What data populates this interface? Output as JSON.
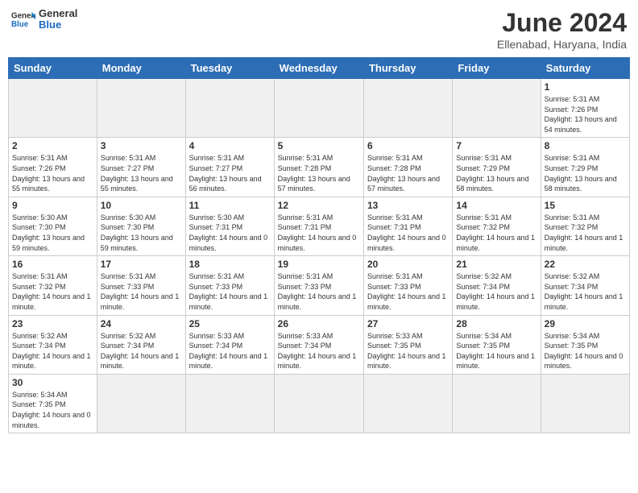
{
  "header": {
    "title": "June 2024",
    "location": "Ellenabad, Haryana, India",
    "logo_general": "General",
    "logo_blue": "Blue"
  },
  "days_of_week": [
    "Sunday",
    "Monday",
    "Tuesday",
    "Wednesday",
    "Thursday",
    "Friday",
    "Saturday"
  ],
  "weeks": [
    {
      "cells": [
        {
          "day": "",
          "empty": true
        },
        {
          "day": "",
          "empty": true
        },
        {
          "day": "",
          "empty": true
        },
        {
          "day": "",
          "empty": true
        },
        {
          "day": "",
          "empty": true
        },
        {
          "day": "",
          "empty": true
        },
        {
          "day": "1",
          "sunrise": "5:31 AM",
          "sunset": "7:26 PM",
          "daylight": "13 hours and 54 minutes."
        }
      ]
    },
    {
      "cells": [
        {
          "day": "2",
          "sunrise": "5:31 AM",
          "sunset": "7:26 PM",
          "daylight": "13 hours and 55 minutes."
        },
        {
          "day": "3",
          "sunrise": "5:31 AM",
          "sunset": "7:27 PM",
          "daylight": "13 hours and 55 minutes."
        },
        {
          "day": "4",
          "sunrise": "5:31 AM",
          "sunset": "7:27 PM",
          "daylight": "13 hours and 56 minutes."
        },
        {
          "day": "5",
          "sunrise": "5:31 AM",
          "sunset": "7:28 PM",
          "daylight": "13 hours and 57 minutes."
        },
        {
          "day": "6",
          "sunrise": "5:31 AM",
          "sunset": "7:28 PM",
          "daylight": "13 hours and 57 minutes."
        },
        {
          "day": "7",
          "sunrise": "5:31 AM",
          "sunset": "7:29 PM",
          "daylight": "13 hours and 58 minutes."
        },
        {
          "day": "8",
          "sunrise": "5:31 AM",
          "sunset": "7:29 PM",
          "daylight": "13 hours and 58 minutes."
        }
      ]
    },
    {
      "cells": [
        {
          "day": "9",
          "sunrise": "5:30 AM",
          "sunset": "7:30 PM",
          "daylight": "13 hours and 59 minutes."
        },
        {
          "day": "10",
          "sunrise": "5:30 AM",
          "sunset": "7:30 PM",
          "daylight": "13 hours and 59 minutes."
        },
        {
          "day": "11",
          "sunrise": "5:30 AM",
          "sunset": "7:31 PM",
          "daylight": "14 hours and 0 minutes."
        },
        {
          "day": "12",
          "sunrise": "5:31 AM",
          "sunset": "7:31 PM",
          "daylight": "14 hours and 0 minutes."
        },
        {
          "day": "13",
          "sunrise": "5:31 AM",
          "sunset": "7:31 PM",
          "daylight": "14 hours and 0 minutes."
        },
        {
          "day": "14",
          "sunrise": "5:31 AM",
          "sunset": "7:32 PM",
          "daylight": "14 hours and 1 minute."
        },
        {
          "day": "15",
          "sunrise": "5:31 AM",
          "sunset": "7:32 PM",
          "daylight": "14 hours and 1 minute."
        }
      ]
    },
    {
      "cells": [
        {
          "day": "16",
          "sunrise": "5:31 AM",
          "sunset": "7:32 PM",
          "daylight": "14 hours and 1 minute."
        },
        {
          "day": "17",
          "sunrise": "5:31 AM",
          "sunset": "7:33 PM",
          "daylight": "14 hours and 1 minute."
        },
        {
          "day": "18",
          "sunrise": "5:31 AM",
          "sunset": "7:33 PM",
          "daylight": "14 hours and 1 minute."
        },
        {
          "day": "19",
          "sunrise": "5:31 AM",
          "sunset": "7:33 PM",
          "daylight": "14 hours and 1 minute."
        },
        {
          "day": "20",
          "sunrise": "5:31 AM",
          "sunset": "7:33 PM",
          "daylight": "14 hours and 1 minute."
        },
        {
          "day": "21",
          "sunrise": "5:32 AM",
          "sunset": "7:34 PM",
          "daylight": "14 hours and 1 minute."
        },
        {
          "day": "22",
          "sunrise": "5:32 AM",
          "sunset": "7:34 PM",
          "daylight": "14 hours and 1 minute."
        }
      ]
    },
    {
      "cells": [
        {
          "day": "23",
          "sunrise": "5:32 AM",
          "sunset": "7:34 PM",
          "daylight": "14 hours and 1 minute."
        },
        {
          "day": "24",
          "sunrise": "5:32 AM",
          "sunset": "7:34 PM",
          "daylight": "14 hours and 1 minute."
        },
        {
          "day": "25",
          "sunrise": "5:33 AM",
          "sunset": "7:34 PM",
          "daylight": "14 hours and 1 minute."
        },
        {
          "day": "26",
          "sunrise": "5:33 AM",
          "sunset": "7:34 PM",
          "daylight": "14 hours and 1 minute."
        },
        {
          "day": "27",
          "sunrise": "5:33 AM",
          "sunset": "7:35 PM",
          "daylight": "14 hours and 1 minute."
        },
        {
          "day": "28",
          "sunrise": "5:34 AM",
          "sunset": "7:35 PM",
          "daylight": "14 hours and 1 minute."
        },
        {
          "day": "29",
          "sunrise": "5:34 AM",
          "sunset": "7:35 PM",
          "daylight": "14 hours and 0 minutes."
        }
      ]
    },
    {
      "cells": [
        {
          "day": "30",
          "sunrise": "5:34 AM",
          "sunset": "7:35 PM",
          "daylight": "14 hours and 0 minutes."
        },
        {
          "day": "",
          "empty": true
        },
        {
          "day": "",
          "empty": true
        },
        {
          "day": "",
          "empty": true
        },
        {
          "day": "",
          "empty": true
        },
        {
          "day": "",
          "empty": true
        },
        {
          "day": "",
          "empty": true
        }
      ]
    }
  ]
}
